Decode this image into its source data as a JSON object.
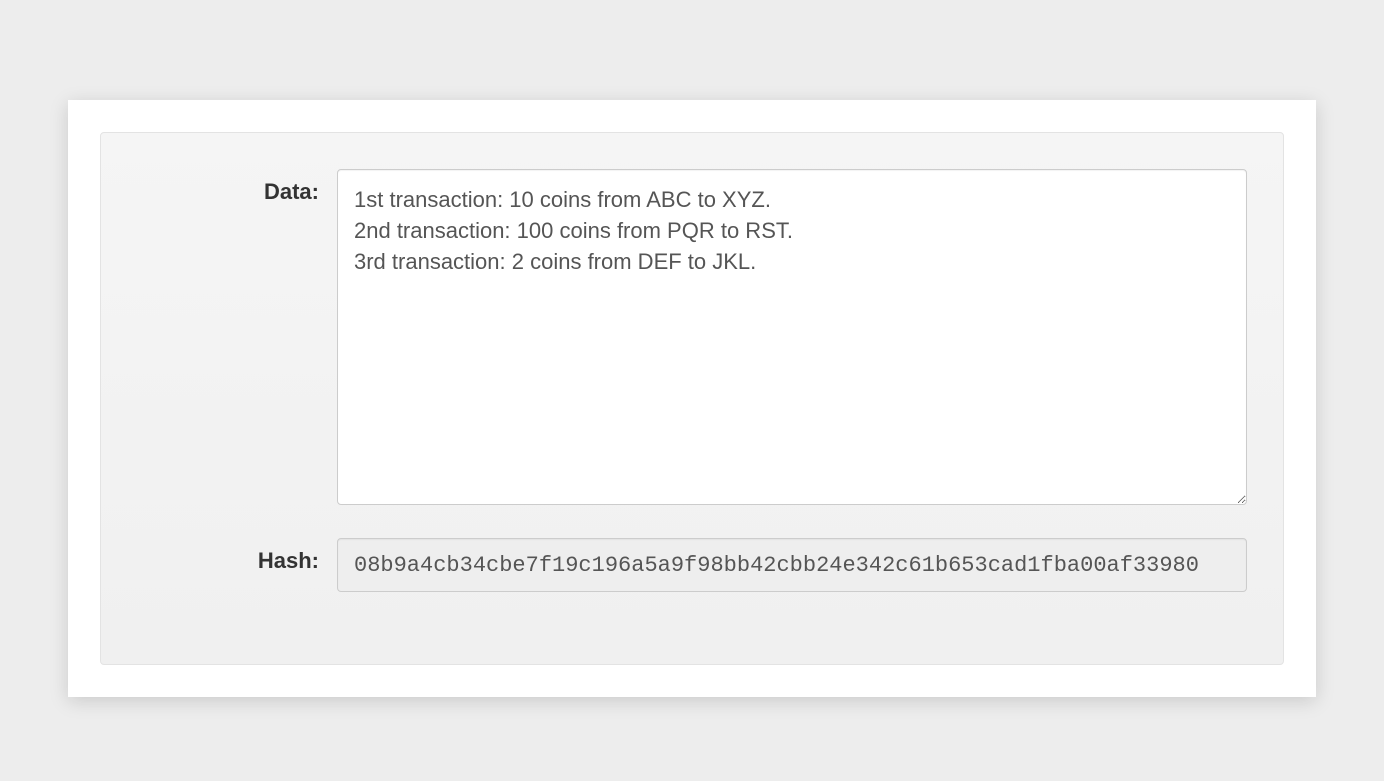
{
  "form": {
    "data_label": "Data:",
    "data_value": "1st transaction: 10 coins from ABC to XYZ.\n2nd transaction: 100 coins from PQR to RST.\n3rd transaction: 2 coins from DEF to JKL.",
    "hash_label": "Hash:",
    "hash_value": "08b9a4cb34cbe7f19c196a5a9f98bb42cbb24e342c61b653cad1fba00af33980"
  }
}
